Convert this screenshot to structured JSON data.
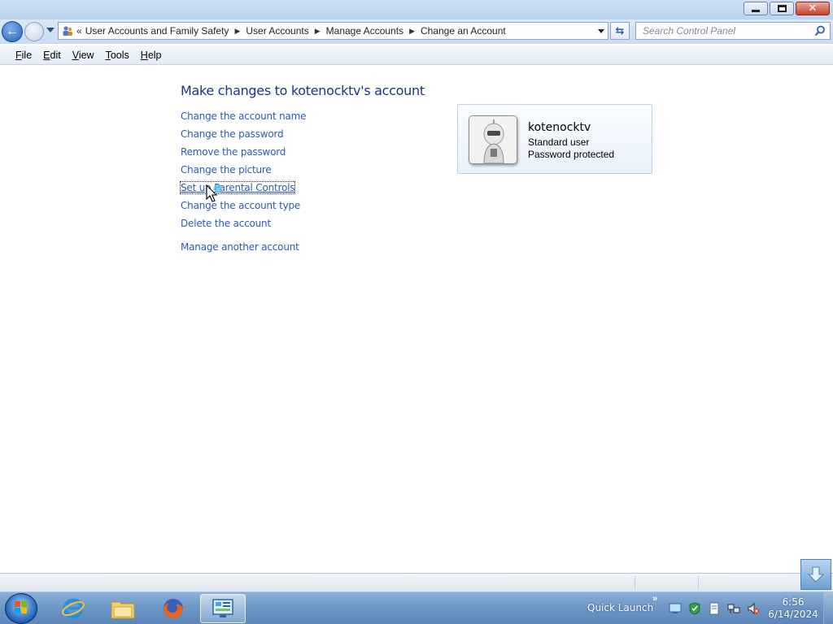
{
  "window": {
    "minimize_label": "",
    "colors": {
      "title_bar": "#c5d9f1",
      "close": "#c6412a"
    }
  },
  "address_bar": {
    "overflow_chevron": "«",
    "breadcrumbs": [
      "User Accounts and Family Safety",
      "User Accounts",
      "Manage Accounts",
      "Change an Account"
    ],
    "icon": "users-folder-icon"
  },
  "search": {
    "placeholder": "Search Control Panel"
  },
  "menu": {
    "items": [
      {
        "label": "File",
        "accel": "F",
        "rest": "ile"
      },
      {
        "label": "Edit",
        "accel": "E",
        "rest": "dit"
      },
      {
        "label": "View",
        "accel": "V",
        "rest": "iew"
      },
      {
        "label": "Tools",
        "accel": "T",
        "rest": "ools"
      },
      {
        "label": "Help",
        "accel": "H",
        "rest": "elp"
      }
    ]
  },
  "main": {
    "title": "Make changes to kotenocktv's account",
    "tasks": [
      "Change the account name",
      "Change the password",
      "Remove the password",
      "Change the picture",
      "Set up Parental Controls",
      "Change the account type",
      "Delete the account"
    ],
    "other_task": "Manage another account",
    "link_color": "#2a5ab8",
    "title_color": "#1e3287"
  },
  "account": {
    "name": "kotenocktv",
    "type": "Standard user",
    "password_status": "Password protected",
    "picture": "robot-avatar-icon"
  },
  "taskbar": {
    "apps": [
      "internet-explorer-icon",
      "windows-explorer-icon",
      "firefox-icon",
      "control-panel-icon"
    ],
    "quick_launch_label": "Quick Launch",
    "quick_launch_chevron": "»",
    "clock_time": "6:56",
    "clock_date": "6/14/2024"
  }
}
